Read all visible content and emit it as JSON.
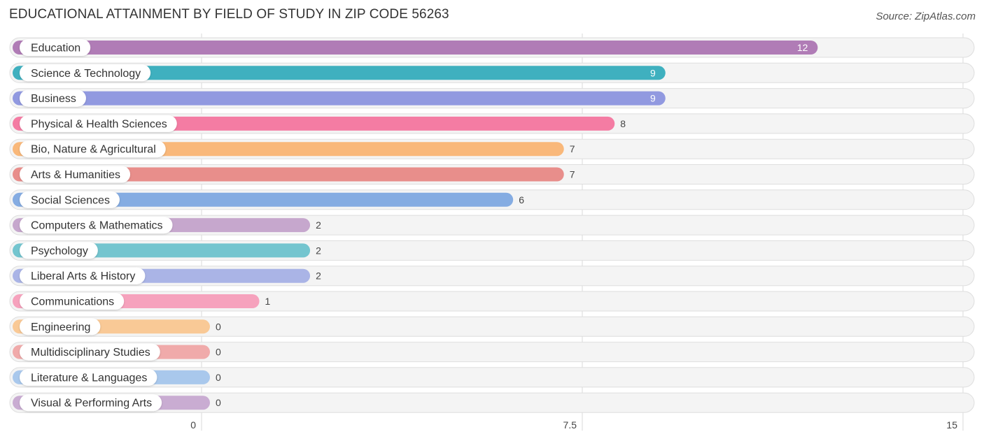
{
  "header": {
    "title": "EDUCATIONAL ATTAINMENT BY FIELD OF STUDY IN ZIP CODE 56263",
    "source": "Source: ZipAtlas.com"
  },
  "chart_data": {
    "type": "bar",
    "orientation": "horizontal",
    "title": "EDUCATIONAL ATTAINMENT BY FIELD OF STUDY IN ZIP CODE 56263",
    "xlabel": "",
    "ylabel": "",
    "xlim": [
      0,
      15
    ],
    "xticks": [
      0,
      7.5,
      15
    ],
    "xtick_labels": [
      "0",
      "7.5",
      "15"
    ],
    "grid": true,
    "categories": [
      "Education",
      "Science & Technology",
      "Business",
      "Physical & Health Sciences",
      "Bio, Nature & Agricultural",
      "Arts & Humanities",
      "Social Sciences",
      "Computers & Mathematics",
      "Psychology",
      "Liberal Arts & History",
      "Communications",
      "Engineering",
      "Multidisciplinary Studies",
      "Literature & Languages",
      "Visual & Performing Arts"
    ],
    "values": [
      12,
      9,
      9,
      8,
      7,
      7,
      6,
      2,
      2,
      2,
      1,
      0,
      0,
      0,
      0
    ],
    "value_labels": [
      "12",
      "9",
      "9",
      "8",
      "7",
      "7",
      "6",
      "2",
      "2",
      "2",
      "1",
      "0",
      "0",
      "0",
      "0"
    ],
    "colors": [
      "#b07cb6",
      "#3fb0bf",
      "#9199e0",
      "#f47ca3",
      "#f9b87a",
      "#e88e8b",
      "#85ace2",
      "#c6a7cd",
      "#74c5cf",
      "#aab4e6",
      "#f6a2bd",
      "#f9c996",
      "#f0aaaa",
      "#a9c8ec",
      "#c9acd2"
    ]
  }
}
